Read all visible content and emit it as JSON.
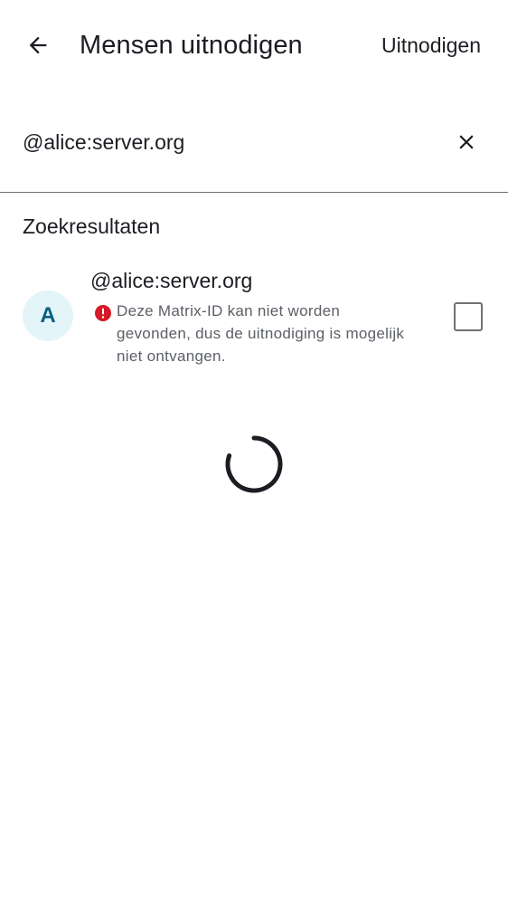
{
  "topbar": {
    "back_icon": "arrow-left-icon",
    "title": "Mensen uitnodigen",
    "invite_label": "Uitnodigen"
  },
  "search": {
    "value": "@alice:server.org",
    "clear_icon": "close-icon"
  },
  "results": {
    "header": "Zoekresultaten",
    "items": [
      {
        "avatar_letter": "A",
        "name": "@alice:server.org",
        "warning_icon": "error-icon",
        "warning": "Deze Matrix-ID kan niet worden gevonden, dus de uitnodiging is mogelijk niet ontvangen.",
        "selected": false
      }
    ]
  },
  "loading": {
    "spinner_icon": "loading-spinner-icon"
  },
  "colors": {
    "text_primary": "#1b1d22",
    "text_secondary": "#5b5f66",
    "avatar_bg": "#e3f5f8",
    "avatar_fg": "#0a5e84",
    "error": "#d51928",
    "divider": "#6f7176"
  }
}
